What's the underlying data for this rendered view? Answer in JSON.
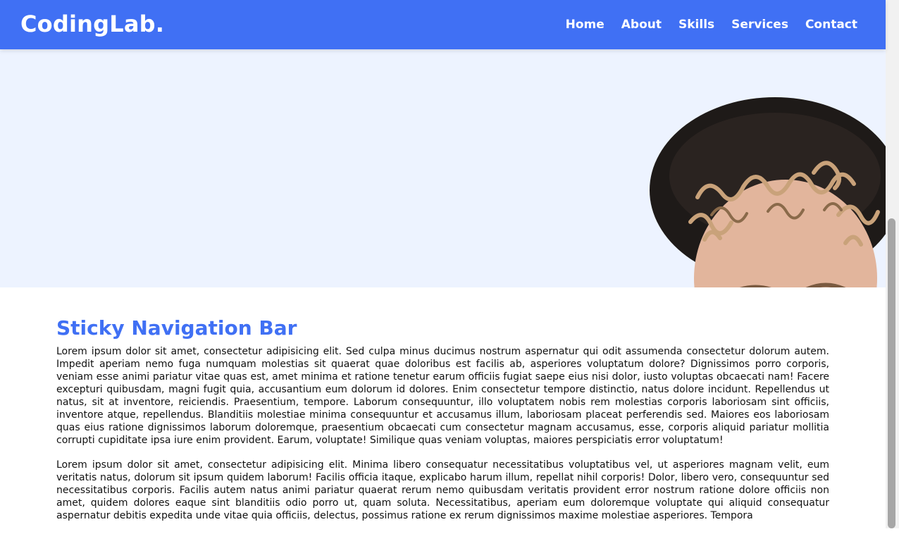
{
  "nav": {
    "logo": "CodingLab.",
    "links": [
      "Home",
      "About",
      "Skills",
      "Services",
      "Contact"
    ]
  },
  "hero": {
    "image": "curly-haired-person-with-hat-photo"
  },
  "main": {
    "heading": "Sticky Navigation Bar",
    "paragraphs": [
      "Lorem ipsum dolor sit amet, consectetur adipisicing elit. Sed culpa minus ducimus nostrum aspernatur qui odit assumenda consectetur dolorum autem. Impedit aperiam nemo fuga numquam molestias sit quaerat quae doloribus est facilis ab, asperiores voluptatum dolore? Dignissimos porro corporis, veniam esse animi pariatur vitae quas est, amet minima et ratione tenetur earum officiis fugiat saepe eius nisi dolor, iusto voluptas obcaecati nam! Facere excepturi quibusdam, magni fugit quia, accusantium eum dolorum id dolores. Enim consectetur tempore distinctio, natus dolore incidunt. Repellendus ut natus, sit at inventore, reiciendis. Praesentium, tempore. Laborum consequuntur, illo voluptatem nobis rem molestias corporis laboriosam sint officiis, inventore atque, repellendus. Blanditiis molestiae minima consequuntur et accusamus illum, laboriosam placeat perferendis sed. Maiores eos laboriosam quas eius ratione dignissimos laborum doloremque, praesentium obcaecati cum consectetur magnam accusamus, esse, corporis aliquid pariatur mollitia corrupti cupiditate ipsa iure enim provident. Earum, voluptate! Similique quas veniam voluptas, maiores perspiciatis error voluptatum!",
      "Lorem ipsum dolor sit amet, consectetur adipisicing elit. Minima libero consequatur necessitatibus voluptatibus vel, ut asperiores magnam velit, eum veritatis natus, dolorum sit ipsum quidem laborum! Facilis officia itaque, explicabo harum illum, repellat nihil corporis! Dolor, libero vero, consequuntur sed necessitatibus corporis. Facilis autem natus animi pariatur quaerat rerum nemo quibusdam veritatis provident error nostrum ratione dolore officiis non amet, quidem dolores eaque sint blanditiis odio porro ut, quam soluta. Necessitatibus, aperiam eum doloremque voluptate qui aliquid consequatur aspernatur debitis expedita unde vitae quia officiis, delectus, possimus ratione ex rerum dignissimos maxime molestiae asperiores. Tempora"
    ]
  },
  "colors": {
    "accent": "#4070f4",
    "hero_bg": "#edf3ff"
  }
}
